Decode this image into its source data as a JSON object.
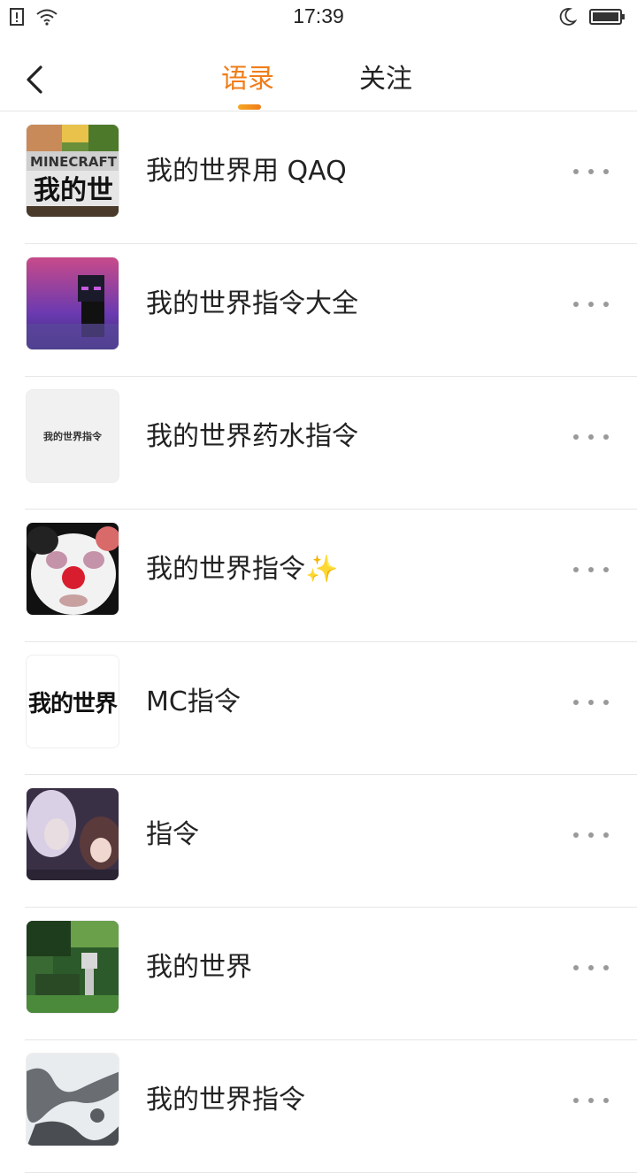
{
  "status_bar": {
    "time": "17:39"
  },
  "nav": {
    "tabs": [
      {
        "label": "语录",
        "active": true
      },
      {
        "label": "关注",
        "active": false
      }
    ],
    "accent_color": "#f07d1a"
  },
  "items": [
    {
      "title": "我的世界用  QAQ",
      "thumb": "minecraft-logo"
    },
    {
      "title": "我的世界指令大全",
      "thumb": "purple-enderman"
    },
    {
      "title": "我的世界药水指令",
      "thumb": "text-card",
      "thumb_text": "我的世界指令"
    },
    {
      "title": "我的世界指令✨",
      "thumb": "clown-panda"
    },
    {
      "title": "MC指令",
      "thumb": "text-card-bold",
      "thumb_text": "我的世界"
    },
    {
      "title": "指令",
      "thumb": "anime-art"
    },
    {
      "title": "我的世界",
      "thumb": "forest-skeleton"
    },
    {
      "title": "我的世界指令",
      "thumb": "snow-texture"
    }
  ]
}
